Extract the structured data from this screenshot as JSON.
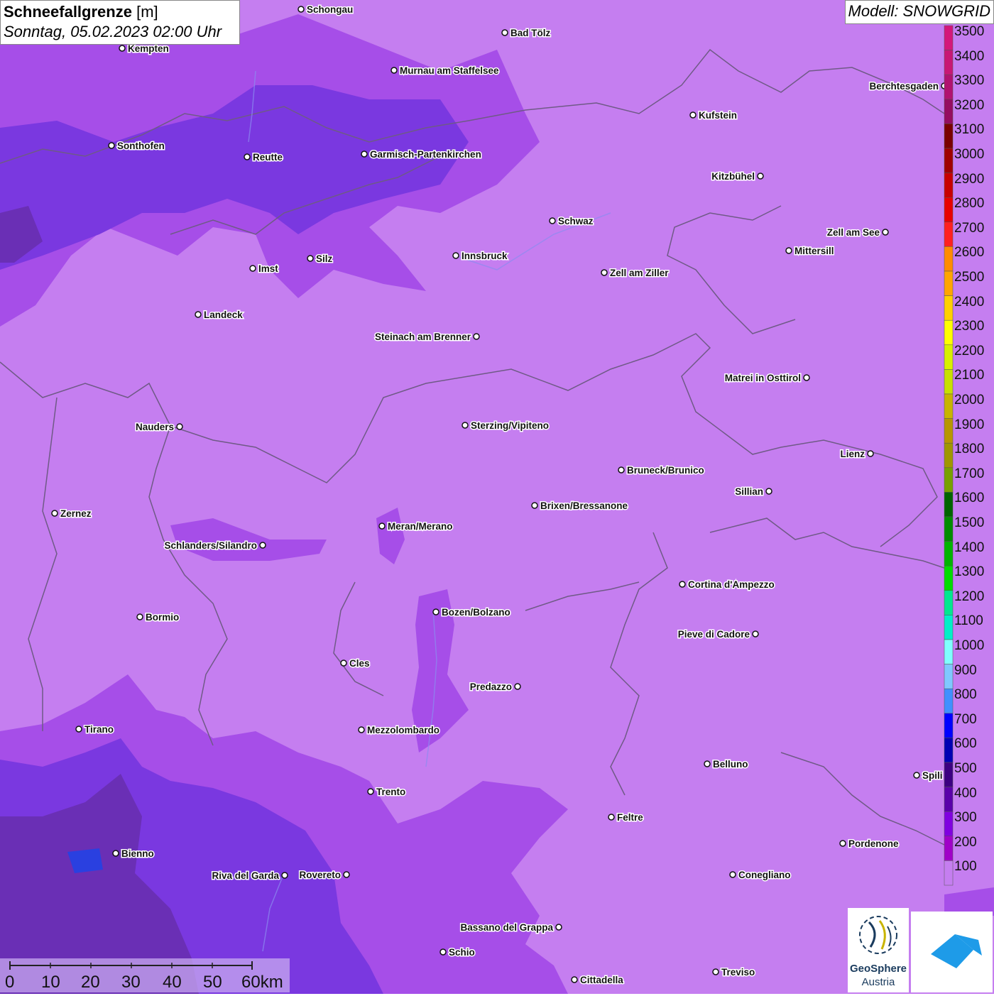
{
  "title": {
    "main": "Schneefallgrenze",
    "unit": "[m]",
    "datetime": "Sonntag, 05.02.2023 02:00 Uhr"
  },
  "model": "Modell: SNOWGRID",
  "colors": {
    "base": "#c57ef0",
    "mid": "#a64ee8",
    "dark": "#7a38e0",
    "deep": "#6a2fb5"
  },
  "legend": {
    "levels": [
      "3500",
      "3400",
      "3300",
      "3200",
      "3100",
      "3000",
      "2900",
      "2800",
      "2700",
      "2600",
      "2500",
      "2400",
      "2300",
      "2200",
      "2100",
      "2000",
      "1900",
      "1800",
      "1700",
      "1600",
      "1500",
      "1400",
      "1300",
      "1200",
      "1100",
      "1000",
      "900",
      "800",
      "700",
      "600",
      "500",
      "400",
      "300",
      "200",
      "100"
    ],
    "colors": [
      "#d4177a",
      "#c81774",
      "#b11270",
      "#950d60",
      "#7a0000",
      "#a00000",
      "#c80000",
      "#e80000",
      "#ff2020",
      "#ff8c00",
      "#ffa500",
      "#ffd000",
      "#ffff00",
      "#d8f000",
      "#c8e000",
      "#c8b400",
      "#b89600",
      "#a09600",
      "#78a000",
      "#006400",
      "#008c00",
      "#00b400",
      "#00dc00",
      "#00e890",
      "#00f0c8",
      "#80ffff",
      "#80c8ff",
      "#4090ff",
      "#0000ff",
      "#0000b4",
      "#3c0082",
      "#5a00aa",
      "#8000e0",
      "#a000c8",
      "#c57ef0"
    ]
  },
  "cities": [
    {
      "name": "Schongau"
    },
    {
      "name": "Bad Tölz"
    },
    {
      "name": "Kempten"
    },
    {
      "name": "Murnau am Staffelsee"
    },
    {
      "name": "Kufstein"
    },
    {
      "name": "Berchtesgaden"
    },
    {
      "name": "Sonthofen"
    },
    {
      "name": "Reutte"
    },
    {
      "name": "Garmisch-Partenkirchen"
    },
    {
      "name": "Kitzbühel"
    },
    {
      "name": "Schwaz"
    },
    {
      "name": "Zell am See"
    },
    {
      "name": "Innsbruck"
    },
    {
      "name": "Mittersill"
    },
    {
      "name": "Imst"
    },
    {
      "name": "Silz"
    },
    {
      "name": "Zell am Ziller"
    },
    {
      "name": "Landeck"
    },
    {
      "name": "Steinach am Brenner"
    },
    {
      "name": "Matrei in Osttirol"
    },
    {
      "name": "Nauders"
    },
    {
      "name": "Sterzing/Vipiteno"
    },
    {
      "name": "Lienz"
    },
    {
      "name": "Bruneck/Brunico"
    },
    {
      "name": "Sillian"
    },
    {
      "name": "Zernez"
    },
    {
      "name": "Brixen/Bressanone"
    },
    {
      "name": "Meran/Merano"
    },
    {
      "name": "Schlanders/Silandro"
    },
    {
      "name": "Cortina d'Ampezzo"
    },
    {
      "name": "Bozen/Bolzano"
    },
    {
      "name": "Bormio"
    },
    {
      "name": "Pieve di Cadore"
    },
    {
      "name": "Cles"
    },
    {
      "name": "Predazzo"
    },
    {
      "name": "Tirano"
    },
    {
      "name": "Mezzolombardo"
    },
    {
      "name": "Belluno"
    },
    {
      "name": "Spili"
    },
    {
      "name": "Trento"
    },
    {
      "name": "Feltre"
    },
    {
      "name": "Pordenone"
    },
    {
      "name": "Bienno"
    },
    {
      "name": "Riva del Garda"
    },
    {
      "name": "Rovereto"
    },
    {
      "name": "Conegliano"
    },
    {
      "name": "Bassano del Grappa"
    },
    {
      "name": "Schio"
    },
    {
      "name": "Treviso"
    },
    {
      "name": "Cittadella"
    }
  ],
  "scale": {
    "labels": [
      "0",
      "10",
      "20",
      "30",
      "40",
      "50",
      "60km"
    ]
  },
  "logos": {
    "geo_line1": "GeoSphere",
    "geo_line2": "Austria"
  }
}
